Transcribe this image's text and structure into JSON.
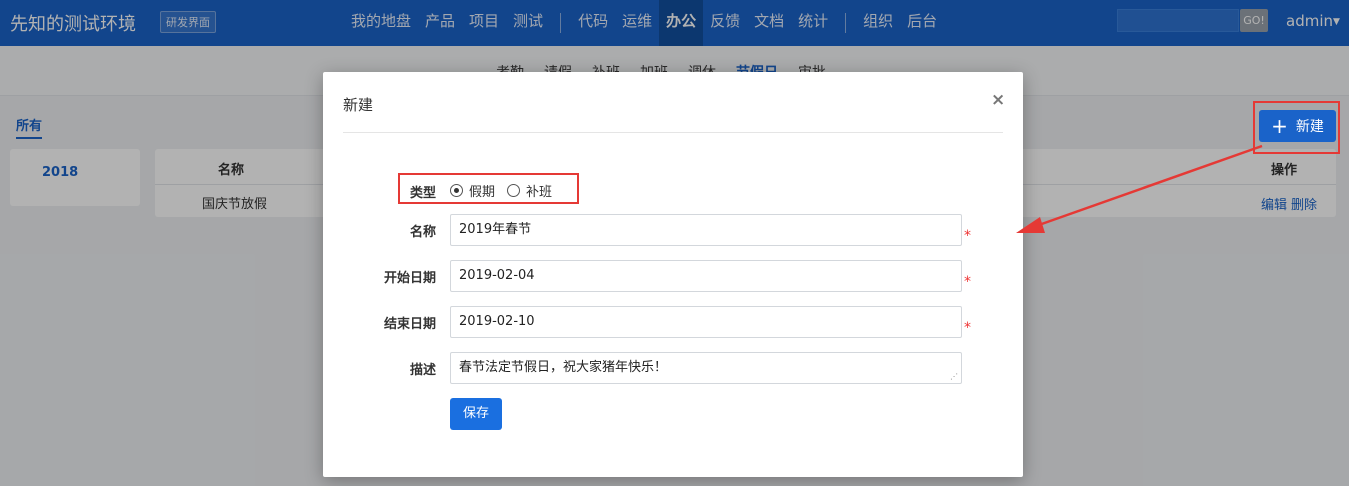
{
  "header": {
    "brand": "先知的测试环境",
    "brand_tag": "研发界面",
    "nav": [
      "我的地盘",
      "产品",
      "项目",
      "测试",
      "代码",
      "运维",
      "办公",
      "反馈",
      "文档",
      "统计",
      "组织",
      "后台"
    ],
    "active_nav": "办公",
    "search_button": "GO!",
    "user": "admin"
  },
  "subnav": {
    "items": [
      "考勤",
      "请假",
      "补班",
      "加班",
      "调休",
      "节假日",
      "审批"
    ],
    "active": "节假日"
  },
  "content": {
    "tab_all": "所有",
    "new_button": "新建",
    "years": [
      "2018"
    ],
    "table": {
      "headers": {
        "name": "名称",
        "ops": "操作"
      },
      "rows": [
        {
          "name": "国庆节放假",
          "edit": "编辑",
          "delete": "删除"
        }
      ]
    }
  },
  "modal": {
    "title": "新建",
    "close": "×",
    "fields": {
      "type_label": "类型",
      "type_options": [
        "假期",
        "补班"
      ],
      "type_selected": "假期",
      "name_label": "名称",
      "name_value": "2019年春节",
      "start_label": "开始日期",
      "start_value": "2019-02-04",
      "end_label": "结束日期",
      "end_value": "2019-02-10",
      "desc_label": "描述",
      "desc_value": "春节法定节假日，祝大家猪年快乐！",
      "required_mark": "*"
    },
    "save_button": "保存"
  },
  "colors": {
    "brand_blue": "#1a63c9",
    "annotation_red": "#e53935"
  }
}
